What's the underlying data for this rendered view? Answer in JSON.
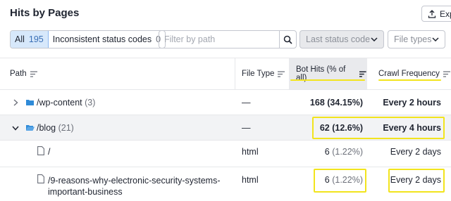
{
  "header": {
    "title": "Hits by Pages",
    "export_label": "Exp"
  },
  "filters": {
    "all": {
      "label": "All",
      "count": "195"
    },
    "inconsistent": {
      "label": "Inconsistent status codes",
      "count": "0"
    },
    "search_placeholder": "Filter by path",
    "last_status": "Last status code",
    "file_types": "File types"
  },
  "columns": {
    "path": "Path",
    "file_type": "File Type",
    "bot_hits": "Bot Hits (% of all)",
    "crawl_frequency": "Crawl Frequency"
  },
  "rows": [
    {
      "path": "/wp-content",
      "count": "(3)",
      "file_type": "—",
      "hits": "168",
      "pct": "(34.15%)",
      "crawl": "Every 2 hours"
    },
    {
      "path": "/blog",
      "count": "(21)",
      "file_type": "—",
      "hits": "62",
      "pct": "(12.6%)",
      "crawl": "Every 4 hours"
    },
    {
      "path": "/",
      "file_type": "html",
      "hits": "6",
      "pct": "(1.22%)",
      "crawl": "Every 2 days"
    },
    {
      "path_line1": "/9-reasons-why-electronic-security-systems-",
      "path_line2": "important-business",
      "file_type": "html",
      "hits": "6",
      "pct": "(1.22%)",
      "crawl": "Every 2 days"
    }
  ],
  "colors": {
    "highlight": "#f2e41d",
    "active_filter": "#d7e8fb",
    "folder": "#2f8bd8"
  }
}
